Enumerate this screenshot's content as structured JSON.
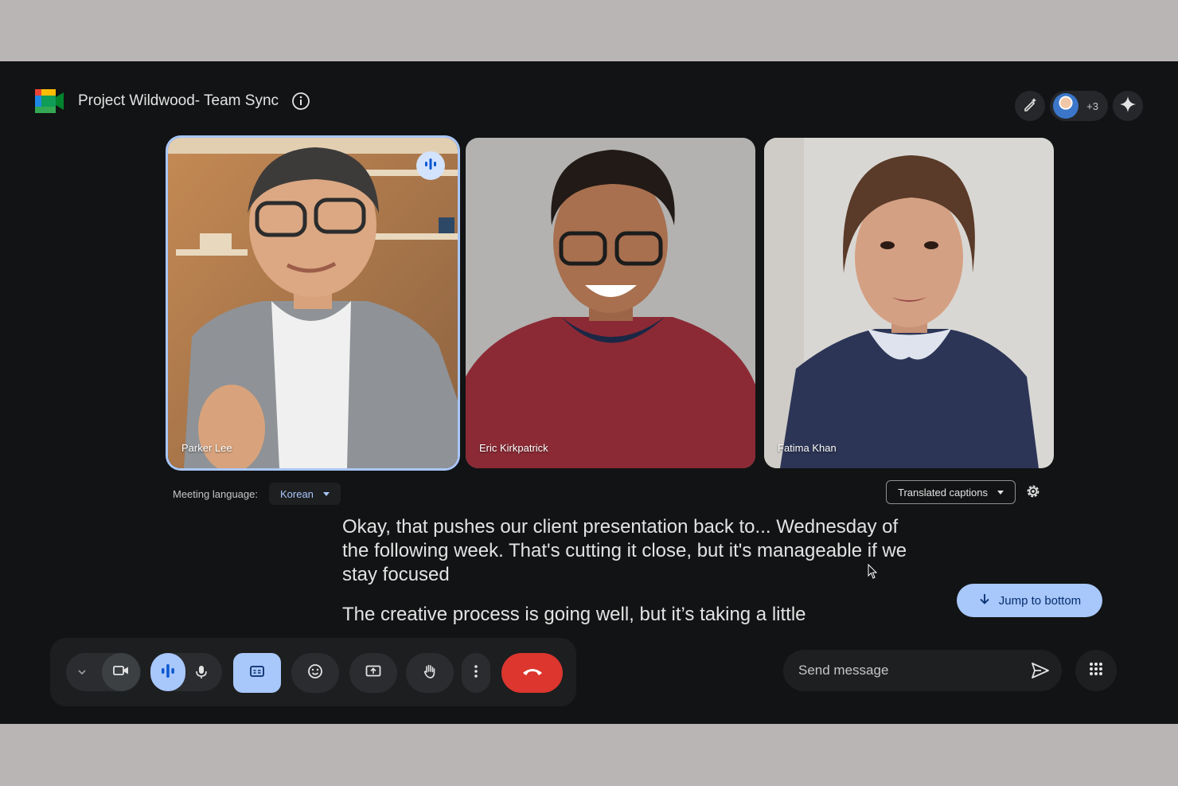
{
  "meeting": {
    "title": "Project Wildwood- Team Sync"
  },
  "participants": {
    "extra_count": "+3",
    "tiles": [
      {
        "name": "Parker Lee",
        "speaking": true
      },
      {
        "name": "Eric Kirkpatrick",
        "speaking": false
      },
      {
        "name": "Fatima Khan",
        "speaking": false
      }
    ]
  },
  "language": {
    "label": "Meeting language:",
    "value": "Korean"
  },
  "captions": {
    "mode": "Translated captions"
  },
  "transcript": {
    "lines": [
      "Okay, that pushes our client presentation back to... Wednesday of the following week. That's cutting it close, but it's manageable if we stay focused",
      "The creative process is going well, but it’s taking a little"
    ]
  },
  "jump": {
    "label": "Jump to bottom"
  },
  "chat": {
    "placeholder": "Send message"
  },
  "colors": {
    "background": "#121314",
    "accent": "#a8c7fa",
    "hangup": "#dc362e"
  }
}
